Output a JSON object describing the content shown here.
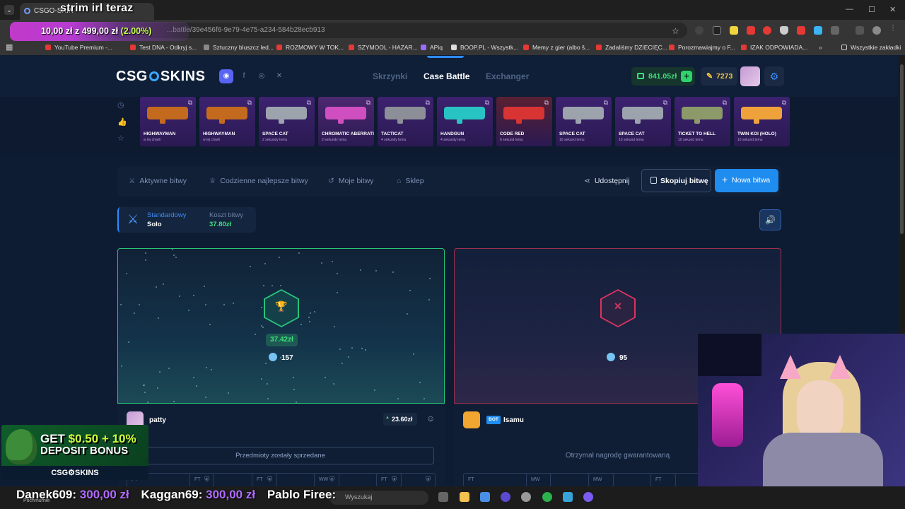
{
  "browser": {
    "tab_title": "CSGO-SKIN",
    "url": "...battle/39e456f6-9e79-4e75-a234-584b28ecb913",
    "bookmarks": [
      "YouTube Premium -...",
      "Test DNA - Odkryj s...",
      "Sztuczny bluszcz led...",
      "ROZMOWY W TOK...",
      "SZYMOOL - HAZAR...",
      "APiq",
      "BOOP.PL - Wszystk...",
      "Memy z gier (albo š...",
      "Zadaliśmy DZIECIĘC...",
      "Porozmawiajmy o F...",
      "IZAK ODPOWIADA...",
      "Wszystkie zakładki"
    ]
  },
  "stream": {
    "title": "strim irl teraz",
    "goal_current": "10,00 zł",
    "goal_sep": "z",
    "goal_target": "499,00 zł",
    "goal_pct": "(2.00%)",
    "promo_line1_a": "GET ",
    "promo_line1_b": "$0.50 + 10%",
    "promo_line2": "DEPOSIT BONUS",
    "promo_brand": "CSG⚙SKINS",
    "donors": [
      {
        "name": "Danek609:",
        "amount": "300,00 zł"
      },
      {
        "name": "Kaggan69:",
        "amount": "300,00 zł"
      },
      {
        "name": "Pablo Firee:",
        "amount": ""
      }
    ],
    "weather": "Pochmurnie",
    "taskbar_search": "Wyszukaj"
  },
  "site": {
    "logo_a": "CSG",
    "logo_b": "SKINS",
    "nav": [
      "Skrzynki",
      "Case Battle",
      "Exchanger"
    ],
    "balance": "841.05zł",
    "coins": "7273",
    "drops": [
      {
        "name": "HIGHWAYMAN",
        "time": "w tej chwili",
        "bg": "#3d2270",
        "gun": "#c46a1f"
      },
      {
        "name": "HIGHWAYMAN",
        "time": "w tej chwili",
        "bg": "#3d2270",
        "gun": "#c46a1f"
      },
      {
        "name": "SPACE CAT",
        "time": "2 sekundy temu",
        "bg": "#3d2270",
        "gun": "#9ca3ad"
      },
      {
        "name": "CHROMATIC ABERRATION",
        "time": "2 sekundy temu",
        "bg": "#4d2870",
        "gun": "#d04fc0"
      },
      {
        "name": "TACTICAT",
        "time": "4 sekundy temu",
        "bg": "#3d2270",
        "gun": "#8c8f97"
      },
      {
        "name": "HANDGUN",
        "time": "4 sekundy temu",
        "bg": "#3d2270",
        "gun": "#28c4c4"
      },
      {
        "name": "CODE RED",
        "time": "6 sekund temu",
        "bg": "#5a2032",
        "gun": "#d93434"
      },
      {
        "name": "SPACE CAT",
        "time": "10 sekund temu",
        "bg": "#3d2270",
        "gun": "#9ca3ad"
      },
      {
        "name": "SPACE CAT",
        "time": "10 sekund temu",
        "bg": "#3d2270",
        "gun": "#9ca3ad"
      },
      {
        "name": "TICKET TO HELL",
        "time": "10 sekund temu",
        "bg": "#3d2270",
        "gun": "#8c9a6a"
      },
      {
        "name": "TWIN KOI (HOLO)",
        "time": "10 sekund temu",
        "bg": "#3d2270",
        "gun": "#f0a23a"
      }
    ],
    "toolbar": {
      "tabs": [
        "Aktywne bitwy",
        "Codzienne najlepsze bitwy",
        "Moje bitwy",
        "Sklep"
      ],
      "share": "Udostępnij",
      "copy": "Skopiuj bitwę",
      "new": "Nowa bitwa"
    },
    "mode": {
      "label": "Standardowy",
      "value": "Solo",
      "cost_label": "Koszt bitwy",
      "cost": "37.80zł"
    },
    "players": [
      {
        "name": "patty",
        "win_value": "37.42zł",
        "points": "157",
        "profit": "23.60zł",
        "status": "Przedmioty zostały sprzedane",
        "slots": [
          "FT",
          "FT",
          "FT",
          "WW",
          "FT"
        ]
      },
      {
        "name": "Isamu",
        "bot": "BOT",
        "points": "95",
        "status": "Otrzymał nagrodę gwarantowaną",
        "slots": [
          "FT",
          "MW",
          "MW",
          "FT"
        ]
      }
    ]
  },
  "colors": {
    "accent": "#1f8cf0",
    "win": "#27c37a",
    "lose": "#d9345f",
    "money": "#3ee07c"
  }
}
